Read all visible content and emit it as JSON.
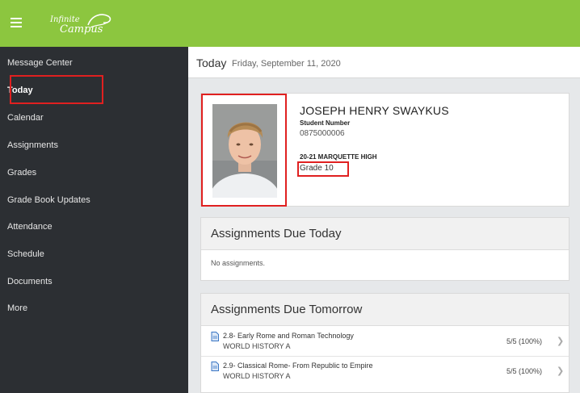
{
  "header": {
    "menu_icon": "hamburger-icon",
    "logo_top": "Infinite",
    "logo_bottom": "Campus",
    "brand_color": "#8cc63f"
  },
  "sidebar": {
    "items": [
      {
        "label": "Message Center"
      },
      {
        "label": "Today",
        "active": true
      },
      {
        "label": "Calendar"
      },
      {
        "label": "Assignments"
      },
      {
        "label": "Grades"
      },
      {
        "label": "Grade Book Updates"
      },
      {
        "label": "Attendance"
      },
      {
        "label": "Schedule"
      },
      {
        "label": "Documents"
      },
      {
        "label": "More"
      }
    ]
  },
  "page": {
    "title": "Today",
    "date": "Friday, September 11, 2020"
  },
  "student": {
    "name": "JOSEPH HENRY SWAYKUS",
    "number_label": "Student Number",
    "number": "0875000006",
    "school": "20-21 MARQUETTE HIGH",
    "grade": "Grade 10"
  },
  "due_today": {
    "title": "Assignments Due Today",
    "empty_text": "No assignments."
  },
  "due_tomorrow": {
    "title": "Assignments Due Tomorrow",
    "items": [
      {
        "name": "2.8- Early Rome and Roman Technology",
        "course": "WORLD HISTORY A",
        "score": "5/5 (100%)"
      },
      {
        "name": "2.9- Classical Rome- From Republic to Empire",
        "course": "WORLD HISTORY A",
        "score": "5/5 (100%)"
      }
    ]
  },
  "annotation_color": "#e02020"
}
